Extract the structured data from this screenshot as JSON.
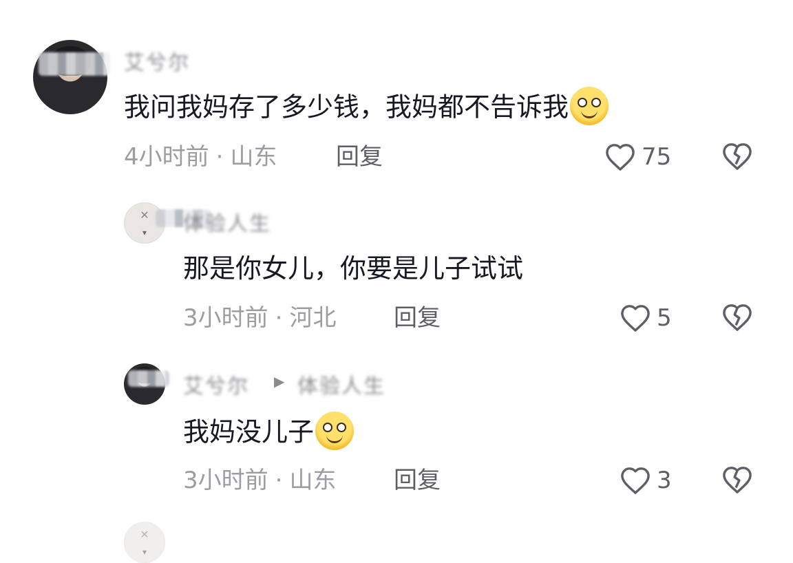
{
  "comments": [
    {
      "username": "艾兮尔",
      "text": "我问我妈存了多少钱，我妈都不告诉我",
      "emoji": "pleading-face-emoji",
      "time": "4小时前",
      "location": "山东",
      "reply_label": "回复",
      "likes": "75"
    },
    {
      "username": "体验人生",
      "text": "那是你女儿，你要是儿子试试",
      "time": "3小时前",
      "location": "河北",
      "reply_label": "回复",
      "likes": "5"
    },
    {
      "username": "艾兮尔",
      "reply_to": "体验人生",
      "text": "我妈没儿子",
      "emoji": "grinning-emoji",
      "time": "3小时前",
      "location": "山东",
      "reply_label": "回复",
      "likes": "3"
    }
  ],
  "separator_dot": "·",
  "icons": {
    "like": "heart-outline-icon",
    "dislike": "broken-heart-icon"
  },
  "colors": {
    "text": "#161823",
    "meta": "#9c9da3",
    "icon": "#5e5f66"
  }
}
